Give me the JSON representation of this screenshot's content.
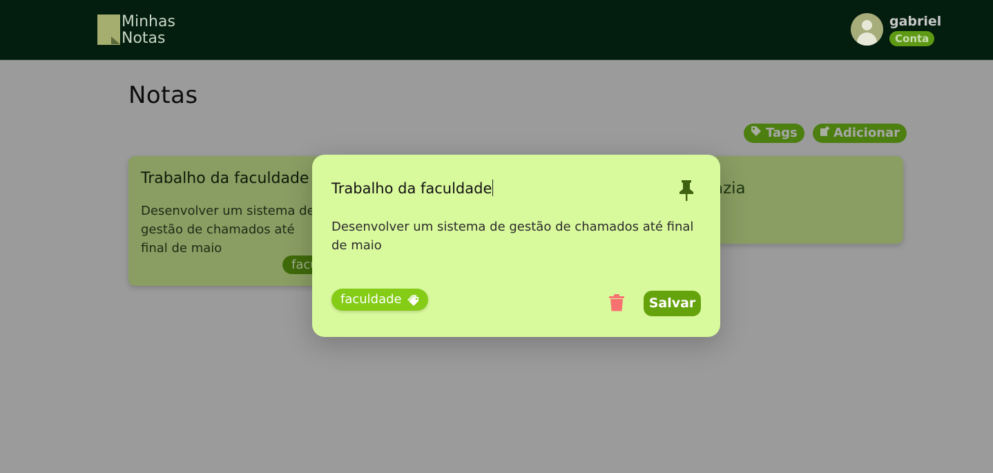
{
  "app": {
    "logo_line1": "Minhas",
    "logo_line2": "Notas"
  },
  "user": {
    "name": "gabriel",
    "account_label": "Conta"
  },
  "page": {
    "title": "Notas"
  },
  "toolbar": {
    "tags_label": "Tags",
    "add_label": "Adicionar"
  },
  "notes": [
    {
      "title": "Trabalho da faculdade",
      "body": "Desenvolver um sistema de gestão de chamados até final de maio",
      "tag": "faculdade"
    },
    {
      "title": "vazia",
      "title_visible": "azia"
    }
  ],
  "editor": {
    "title_value": "Trabalho da faculdade",
    "body_value": "Desenvolver um sistema de gestão de chamados até final de maio",
    "tag": "faculdade",
    "save_label": "Salvar"
  },
  "colors": {
    "header_bg": "#031d0e",
    "accent": "#65a30d",
    "modal_bg": "#d9f99d",
    "tag_bg": "#84cc16",
    "delete": "#f87171"
  },
  "icons": [
    "tag-icon",
    "note-add-icon",
    "pin-icon",
    "trash-icon",
    "user-avatar-icon"
  ]
}
